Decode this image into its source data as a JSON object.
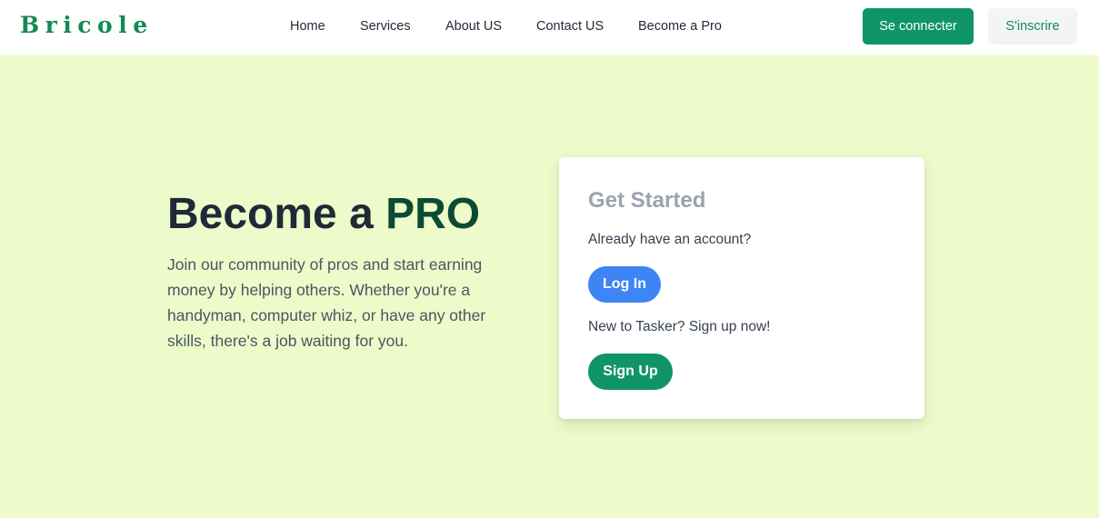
{
  "brand": {
    "name": "Bricole"
  },
  "nav": {
    "links": [
      {
        "label": "Home"
      },
      {
        "label": "Services"
      },
      {
        "label": "About US"
      },
      {
        "label": "Contact US"
      },
      {
        "label": "Become a Pro"
      }
    ],
    "login_label": "Se connecter",
    "register_label": "S'inscrire"
  },
  "hero": {
    "title_prefix": "Become a",
    "title_highlight": "PRO",
    "description": "Join our community of pros and start earning money by helping others. Whether you're a handyman, computer whiz, or have any other skills, there's a job waiting for you."
  },
  "card": {
    "title": "Get Started",
    "existing_prompt": "Already have an account?",
    "login_button": "Log In",
    "new_prompt": "New to Tasker? Sign up now!",
    "signup_button": "Sign Up"
  },
  "colors": {
    "brand_green": "#138a55",
    "primary_button": "#0f9565",
    "login_blue": "#3d84f5",
    "hero_background": "#ecfbc9",
    "pro_highlight": "#0c4a33"
  }
}
